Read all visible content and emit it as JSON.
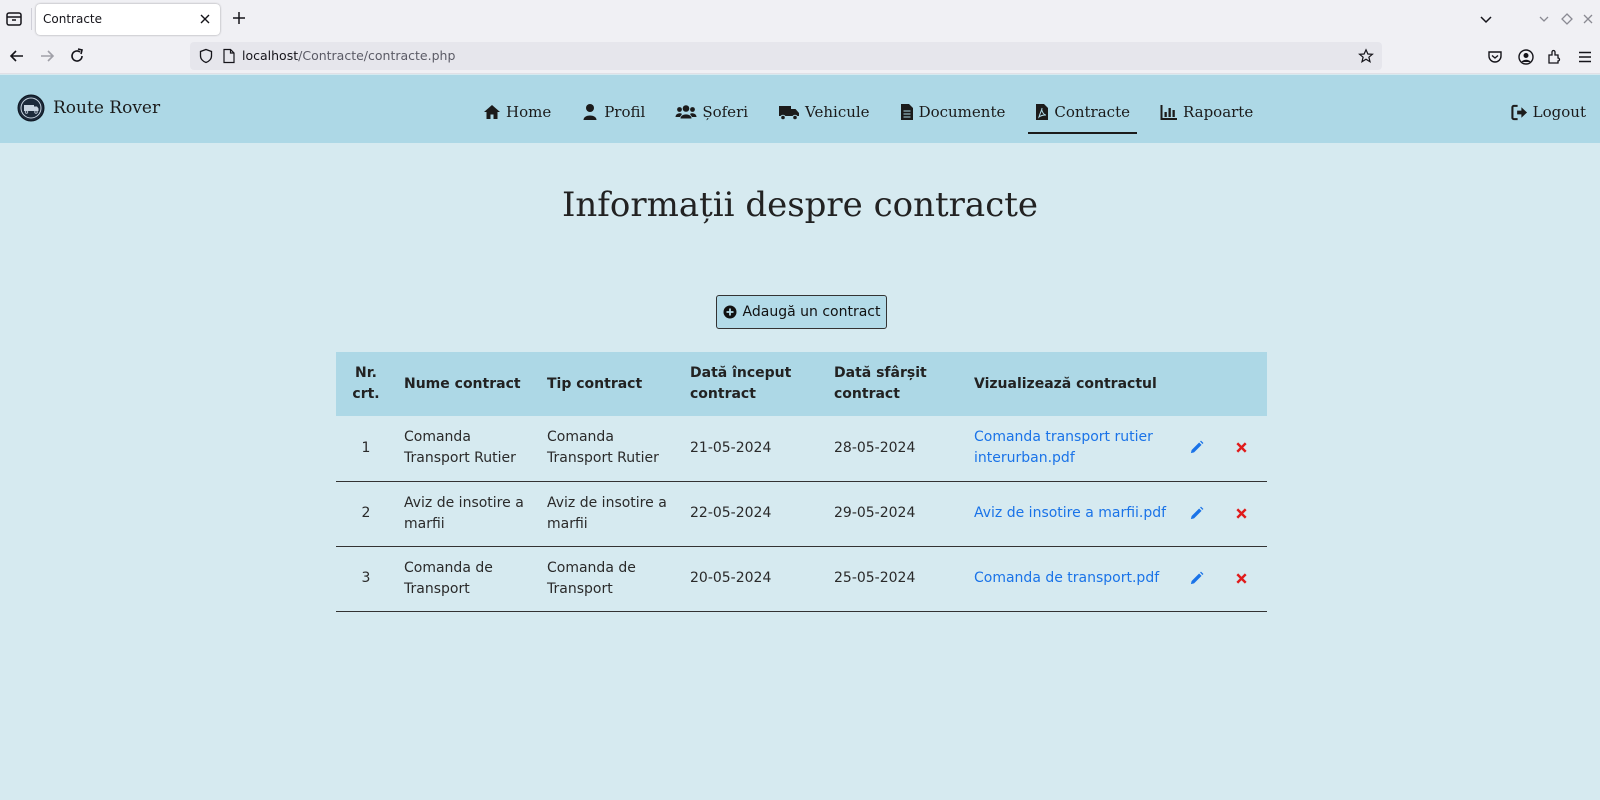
{
  "browser": {
    "tab_title": "Contracte",
    "url_host": "localhost",
    "url_path": "/Contracte/contracte.php"
  },
  "brand": {
    "name": "Route Rover"
  },
  "menu": {
    "items": [
      {
        "label": "Home",
        "icon": "home-icon"
      },
      {
        "label": "Profil",
        "icon": "user-icon"
      },
      {
        "label": "Șoferi",
        "icon": "users-icon"
      },
      {
        "label": "Vehicule",
        "icon": "truck-icon"
      },
      {
        "label": "Documente",
        "icon": "file-icon"
      },
      {
        "label": "Contracte",
        "icon": "file-pdf-icon",
        "active": true
      },
      {
        "label": "Rapoarte",
        "icon": "chart-bar-icon"
      }
    ],
    "logout": "Logout"
  },
  "main": {
    "title": "Informații despre contracte",
    "add_button": "Adaugă un contract"
  },
  "table": {
    "headers": {
      "nr": "Nr. crt.",
      "name": "Nume contract",
      "type": "Tip contract",
      "start": "Dată început contract",
      "end": "Dată sfârșit contract",
      "view": "Vizualizează contractul"
    },
    "rows": [
      {
        "nr": "1",
        "name": "Comanda Transport Rutier",
        "type": "Comanda Transport Rutier",
        "start": "21-05-2024",
        "end": "28-05-2024",
        "file": "Comanda transport rutier interurban.pdf"
      },
      {
        "nr": "2",
        "name": "Aviz de insotire a marfii",
        "type": "Aviz de insotire a marfii",
        "start": "22-05-2024",
        "end": "29-05-2024",
        "file": "Aviz de insotire a marfii.pdf"
      },
      {
        "nr": "3",
        "name": "Comanda de Transport",
        "type": "Comanda de Transport",
        "start": "20-05-2024",
        "end": "25-05-2024",
        "file": "Comanda de transport.pdf"
      }
    ]
  },
  "colors": {
    "navbar_bg": "#add8e6",
    "page_bg": "#d6eaf0",
    "link": "#1a73e8",
    "edit_icon": "#1a73e8",
    "delete_icon": "#e01b1b"
  }
}
